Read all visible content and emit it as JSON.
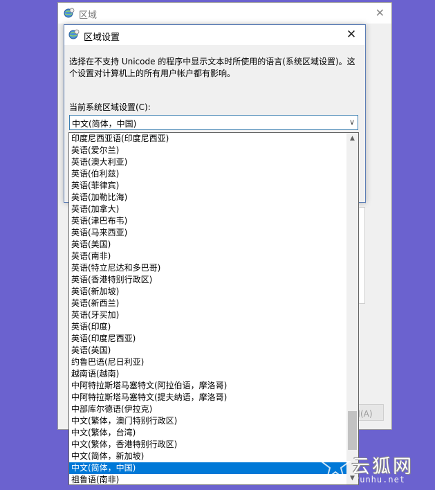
{
  "back_window": {
    "title": "区域",
    "close_glyph": "✕",
    "apply_label": "用(A)"
  },
  "dialog": {
    "title": "区域设置",
    "close_glyph": "✕",
    "description": "选择在不支持 Unicode 的程序中显示文本时所使用的语言(系统区域设置)。这个设置对计算机上的所有用户帐户都有影响。",
    "current_label": "当前系统区域设置(C):",
    "current_value": "中文(简体，中国)"
  },
  "dropdown": {
    "items": [
      "印度尼西亚语(印度尼西亚)",
      "英语(爱尔兰)",
      "英语(澳大利亚)",
      "英语(伯利兹)",
      "英语(菲律宾)",
      "英语(加勒比海)",
      "英语(加拿大)",
      "英语(津巴布韦)",
      "英语(马来西亚)",
      "英语(美国)",
      "英语(南非)",
      "英语(特立尼达和多巴哥)",
      "英语(香港特别行政区)",
      "英语(新加坡)",
      "英语(新西兰)",
      "英语(牙买加)",
      "英语(印度)",
      "英语(印度尼西亚)",
      "英语(英国)",
      "约鲁巴语(尼日利亚)",
      "越南语(越南)",
      "中阿特拉斯塔马塞特文(阿拉伯语，摩洛哥)",
      "中阿特拉斯塔马塞特文(提夫纳语，摩洛哥)",
      "中部库尔德语(伊拉克)",
      "中文(繁体，澳门特别行政区)",
      "中文(繁体，台湾)",
      "中文(繁体，香港特别行政区)",
      "中文(简体，新加坡)",
      "中文(简体，中国)",
      "祖鲁语(南非)"
    ],
    "selected_index": 28,
    "scroll_position": 0.92
  },
  "icons": {
    "app_icon": "globe-clock-icon",
    "scroll_up": "chevron-up-icon",
    "scroll_down": "chevron-down-icon",
    "combo_arrow": "chevron-down-icon"
  },
  "watermark": {
    "text": "云狐网",
    "url": "yunhu.net"
  },
  "colors": {
    "desktop": "#6b62cf",
    "selection": "#0078d7",
    "combo_border": "#3c7fb1"
  }
}
